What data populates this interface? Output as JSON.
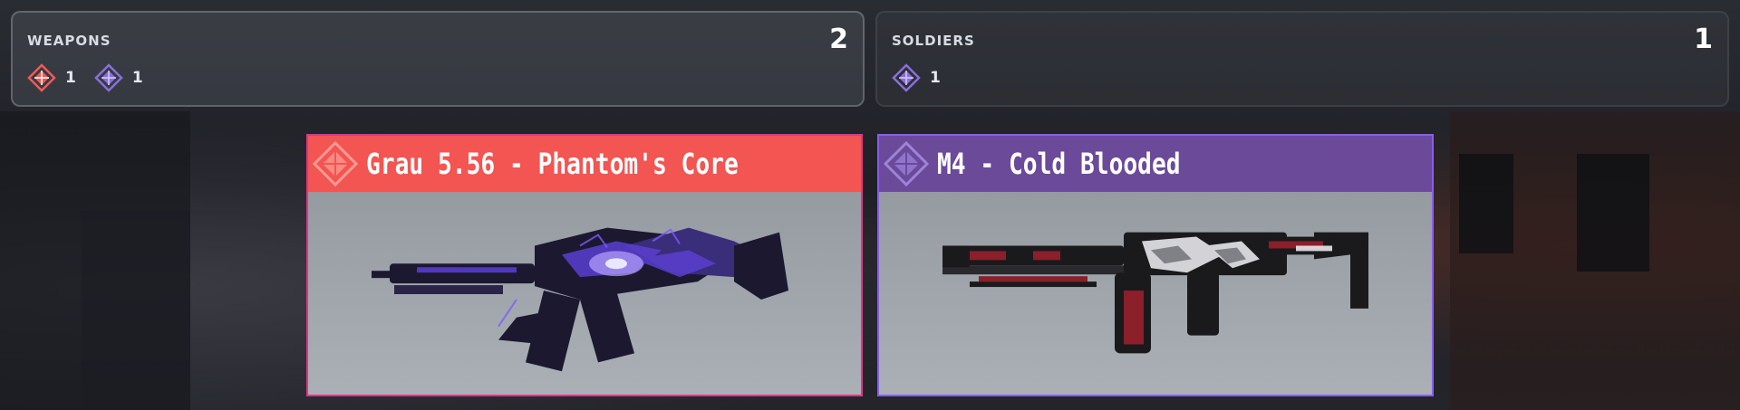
{
  "summary": {
    "weapons": {
      "label": "WEAPONS",
      "total": "2",
      "rarities": [
        {
          "icon": "legendary-rarity-icon",
          "color": "#f25a55",
          "count": "1"
        },
        {
          "icon": "epic-rarity-icon",
          "color": "#8a6fd8",
          "count": "1"
        }
      ]
    },
    "soldiers": {
      "label": "SOLDIERS",
      "total": "1",
      "rarities": [
        {
          "icon": "epic-rarity-icon",
          "color": "#8a6fd8",
          "count": "1"
        }
      ]
    }
  },
  "items": [
    {
      "title": "Grau 5.56 - Phantom's Core",
      "rarity": "legendary",
      "header_color": "#f25552",
      "border_color": "#e0348a",
      "icon": "legendary-rarity-icon",
      "art": "grau-phantoms-core-image"
    },
    {
      "title": "M4 - Cold Blooded",
      "rarity": "epic",
      "header_color": "#6b4a9a",
      "border_color": "#8a5cf0",
      "icon": "epic-rarity-icon",
      "art": "m4-cold-blooded-image"
    }
  ]
}
